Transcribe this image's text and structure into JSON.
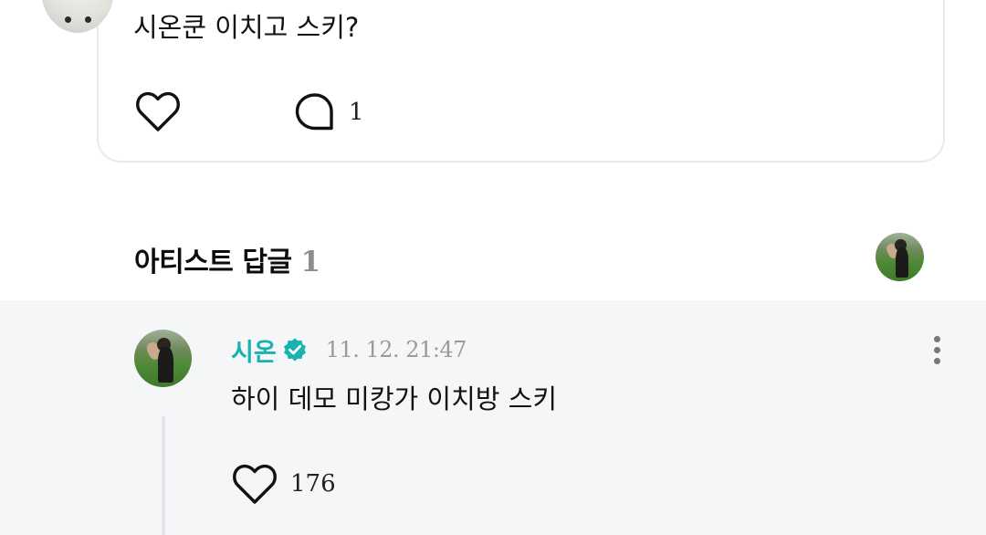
{
  "post": {
    "text": "시온쿤 이치고 스키?",
    "comment_count": "1"
  },
  "artist_replies": {
    "title": "아티스트 답글",
    "count": "1"
  },
  "reply": {
    "author": "시온",
    "timestamp": "11. 12. 21:47",
    "text": "하이 데모 미캉가 이치방 스키",
    "like_count": "176"
  },
  "colors": {
    "accent": "#18b2b0",
    "reply_background": "#f5f6f8",
    "muted_text": "#9a9a9a"
  },
  "icons": [
    "heart-icon",
    "comment-bubble-icon",
    "verified-badge-icon",
    "more-vertical-icon"
  ]
}
